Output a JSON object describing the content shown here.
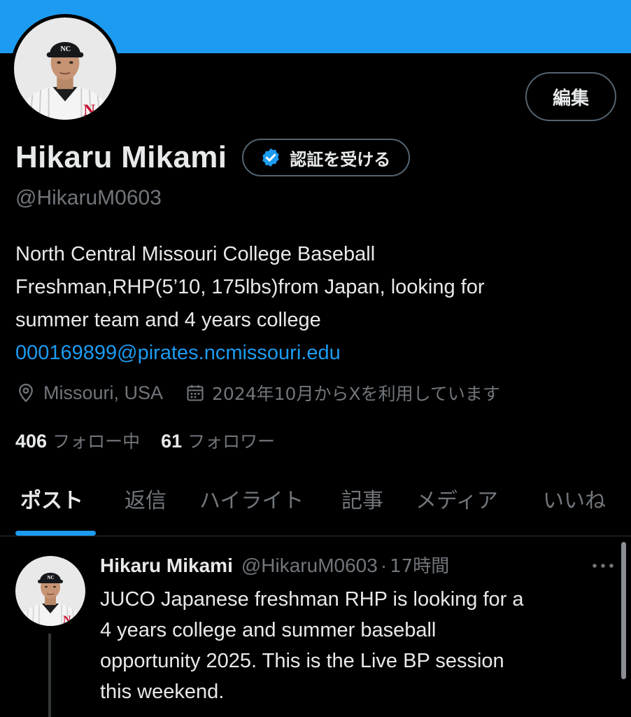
{
  "colors": {
    "accent": "#1d9bf0",
    "background": "#000000",
    "text_primary": "#e7e9ea",
    "text_secondary": "#71767b",
    "border": "#536471"
  },
  "profile": {
    "edit_label": "編集",
    "name": "Hikaru Mikami",
    "verify_label": "認証を受ける",
    "verify_icon": "verified-badge-icon",
    "handle": "@HikaruM0603",
    "bio_lines": [
      "North Central Missouri College Baseball",
      "Freshman,RHP(5’10, 175lbs)from Japan, looking for",
      "summer team and 4 years college"
    ],
    "bio_link": "000169899@pirates.ncmissouri.edu",
    "location_icon": "location-pin-icon",
    "location": "Missouri, USA",
    "joined_icon": "calendar-icon",
    "joined": "2024年10月からXを利用しています",
    "following_count": "406",
    "following_label": "フォロー中",
    "followers_count": "61",
    "followers_label": "フォロワー"
  },
  "tabs": [
    {
      "label": "ポスト",
      "active": true
    },
    {
      "label": "返信",
      "active": false
    },
    {
      "label": "ハイライト",
      "active": false
    },
    {
      "label": "記事",
      "active": false
    },
    {
      "label": "メディア",
      "active": false
    },
    {
      "label": "いいね",
      "active": false
    }
  ],
  "post": {
    "name": "Hikaru Mikami",
    "handle": "@HikaruM0603",
    "separator": "·",
    "time": "17時間",
    "more_icon": "more-options-icon",
    "text_lines": [
      "JUCO Japanese freshman RHP is looking for a",
      "4 years college and summer baseball",
      "opportunity 2025. This is the Live BP session",
      "this weekend."
    ]
  }
}
